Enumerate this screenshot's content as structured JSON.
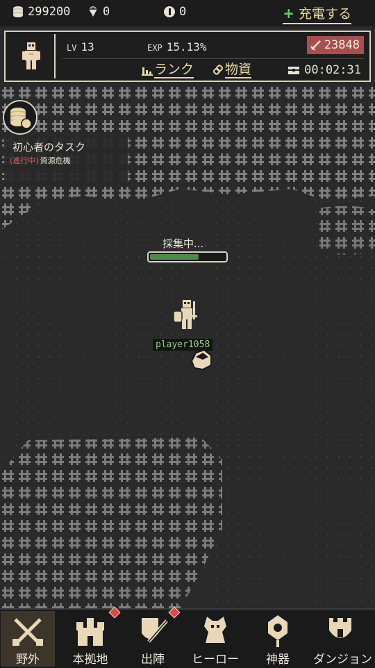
{
  "resources": {
    "coins": "299200",
    "gems": "0",
    "tokens": "0",
    "charge_label": "充電する"
  },
  "profile": {
    "lv_key": "LV",
    "lv_value": "13",
    "exp_key": "EXP",
    "exp_value": "15.13%",
    "power": "23848",
    "rank_label": "ランク",
    "materials_label": "物資",
    "timer": "00:02:31"
  },
  "task": {
    "title": "初心者のタスク",
    "status": "(進行中)",
    "name": "資源危機"
  },
  "gathering": {
    "label": "採集中...",
    "progress": 0.65
  },
  "player": {
    "name": "player1058"
  },
  "nav": [
    {
      "label": "野外",
      "icon": "crossed-swords-icon",
      "active": true,
      "badge": false
    },
    {
      "label": "本拠地",
      "icon": "castle-icon",
      "active": false,
      "badge": true
    },
    {
      "label": "出陣",
      "icon": "sword-shield-icon",
      "active": false,
      "badge": true
    },
    {
      "label": "ヒーロー",
      "icon": "hero-armor-icon",
      "active": false,
      "badge": false
    },
    {
      "label": "神器",
      "icon": "artifact-icon",
      "active": false,
      "badge": false
    },
    {
      "label": "ダンジョン",
      "icon": "tower-icon",
      "active": false,
      "badge": false
    }
  ],
  "colors": {
    "accent": "#e8d8a8",
    "power_bg": "#a84e4e",
    "progress": "#4e8a48",
    "badge": "#e04848"
  }
}
